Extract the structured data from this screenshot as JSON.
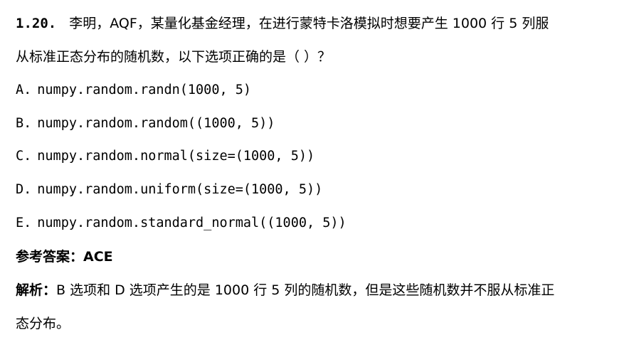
{
  "question": {
    "number": "1.20.",
    "line1_text": "李明，AQF，某量化基金经理，在进行蒙特卡洛模拟时想要产生 1000 行 5 列服",
    "line2_text": "从标准正态分布的随机数，以下选项正确的是（ ）？"
  },
  "options": [
    {
      "letter": "A.",
      "code": "numpy.random.randn(1000, 5)"
    },
    {
      "letter": "B.",
      "code": "numpy.random.random((1000, 5))"
    },
    {
      "letter": "C.",
      "code": "numpy.random.normal(size=(1000, 5))"
    },
    {
      "letter": "D.",
      "code": "numpy.random.uniform(size=(1000, 5))"
    },
    {
      "letter": "E.",
      "code": "numpy.random.standard_normal((1000, 5))"
    }
  ],
  "answer": {
    "label": "参考答案：",
    "value": "ACE"
  },
  "explanation": {
    "label": "解析：",
    "line1_text": "B 选项和 D 选项产生的是 1000 行 5 列的随机数，但是这些随机数并不服从标准正",
    "line2_text": "态分布。"
  }
}
